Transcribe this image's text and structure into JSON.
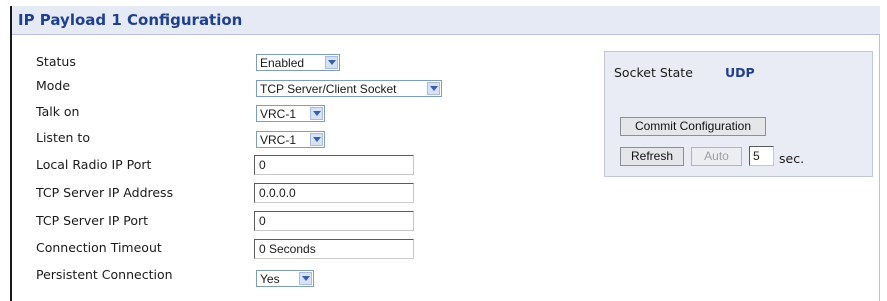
{
  "title": "IP Payload 1 Configuration",
  "form": {
    "status": {
      "label": "Status",
      "value": "Enabled"
    },
    "mode": {
      "label": "Mode",
      "value": "TCP Server/Client Socket"
    },
    "talk_on": {
      "label": "Talk on",
      "value": "VRC-1"
    },
    "listen_to": {
      "label": "Listen to",
      "value": "VRC-1"
    },
    "local_radio_ip_port": {
      "label": "Local Radio IP Port",
      "value": "0"
    },
    "tcp_server_ip_address": {
      "label": "TCP Server IP Address",
      "value": "0.0.0.0"
    },
    "tcp_server_ip_port": {
      "label": "TCP Server IP Port",
      "value": "0"
    },
    "connection_timeout": {
      "label": "Connection Timeout",
      "value": "0 Seconds"
    },
    "persistent_connection": {
      "label": "Persistent Connection",
      "value": "Yes"
    }
  },
  "panel": {
    "socket_state_label": "Socket State",
    "socket_state_value": "UDP",
    "commit_label": "Commit Configuration",
    "refresh_label": "Refresh",
    "auto_label": "Auto",
    "interval_value": "5",
    "interval_unit": "sec."
  },
  "colors": {
    "title_text": "#1f3f8f",
    "title_bar": "#e6eaf5",
    "panel_bg": "#e9ecf5",
    "state_value": "#1f3f8f"
  },
  "icons": {
    "select_arrow": "chevron-down-icon"
  }
}
